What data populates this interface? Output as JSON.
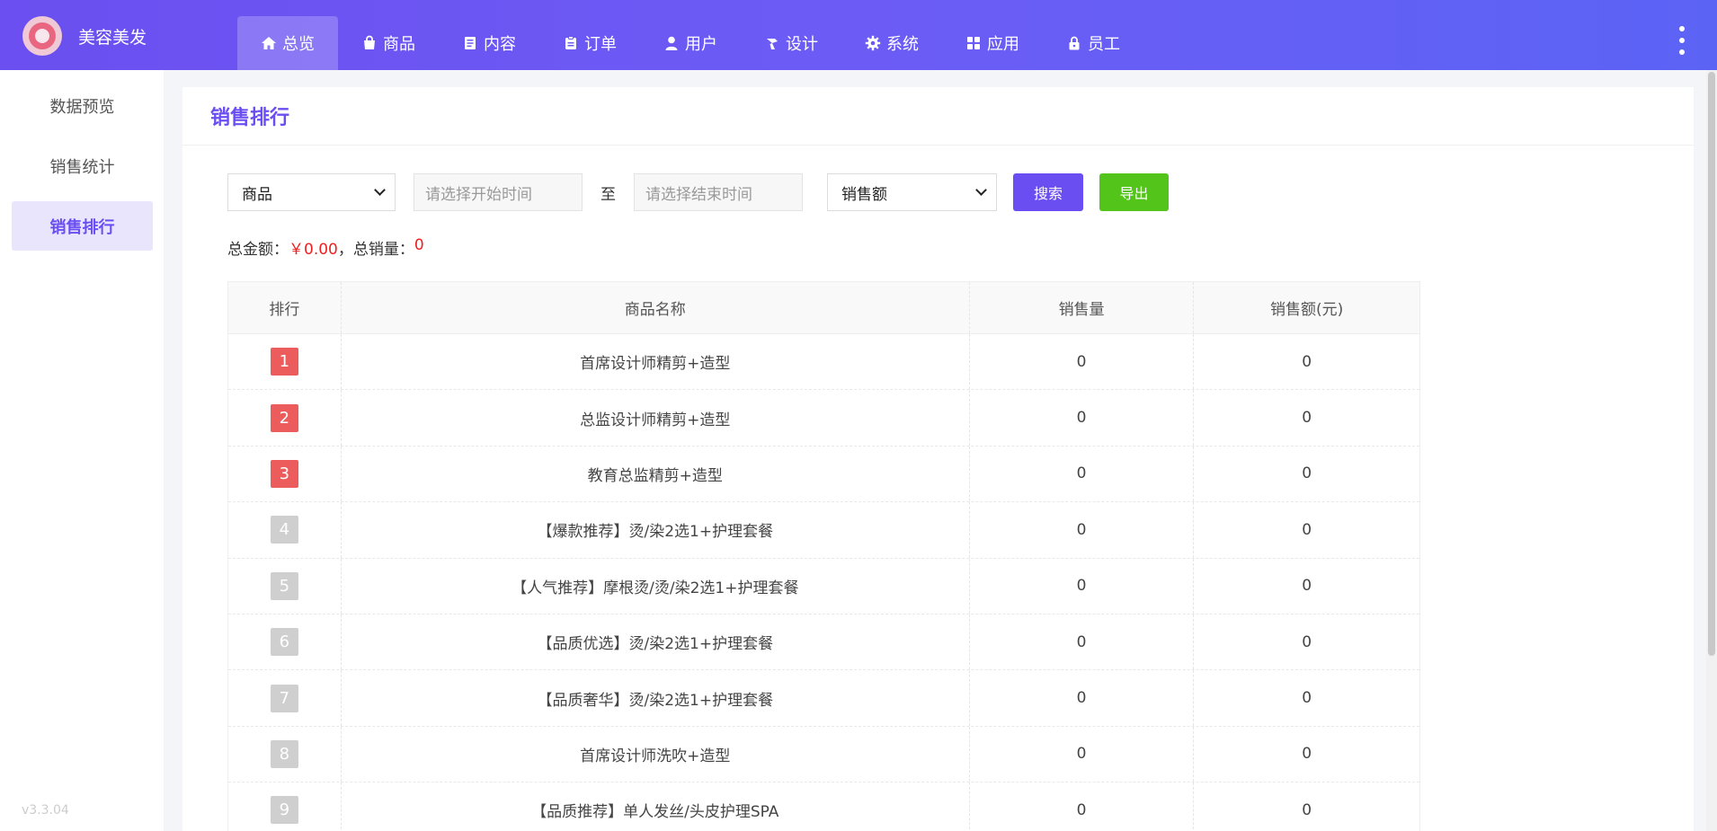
{
  "brand": {
    "name": "美容美发"
  },
  "nav": [
    {
      "label": "总览",
      "icon": "home-icon",
      "active": true
    },
    {
      "label": "商品",
      "icon": "bag-icon"
    },
    {
      "label": "内容",
      "icon": "document-icon"
    },
    {
      "label": "订单",
      "icon": "clipboard-icon"
    },
    {
      "label": "用户",
      "icon": "user-icon"
    },
    {
      "label": "设计",
      "icon": "paint-icon"
    },
    {
      "label": "系统",
      "icon": "gear-icon"
    },
    {
      "label": "应用",
      "icon": "apps-grid-icon"
    },
    {
      "label": "员工",
      "icon": "lock-icon"
    }
  ],
  "sidebar": {
    "items": [
      {
        "label": "数据预览"
      },
      {
        "label": "销售统计"
      },
      {
        "label": "销售排行",
        "active": true
      }
    ],
    "version": "v3.3.04"
  },
  "panel": {
    "title": "销售排行"
  },
  "filters": {
    "type_select": "商品",
    "start_placeholder": "请选择开始时间",
    "to_label": "至",
    "end_placeholder": "请选择结束时间",
    "sort_select": "销售额",
    "search_label": "搜索",
    "export_label": "导出"
  },
  "summary": {
    "amount_label": "总金额：",
    "amount_value": "￥0.00",
    "separator": "，",
    "qty_label": "总销量：",
    "qty_value": "0"
  },
  "table": {
    "headers": [
      "排行",
      "商品名称",
      "销售量",
      "销售额(元)"
    ],
    "rows": [
      {
        "rank": "1",
        "name": "首席设计师精剪+造型",
        "qty": "0",
        "amount": "0"
      },
      {
        "rank": "2",
        "name": "总监设计师精剪+造型",
        "qty": "0",
        "amount": "0"
      },
      {
        "rank": "3",
        "name": "教育总监精剪+造型",
        "qty": "0",
        "amount": "0"
      },
      {
        "rank": "4",
        "name": "【爆款推荐】烫/染2选1+护理套餐",
        "qty": "0",
        "amount": "0"
      },
      {
        "rank": "5",
        "name": "【人气推荐】摩根烫/烫/染2选1+护理套餐",
        "qty": "0",
        "amount": "0"
      },
      {
        "rank": "6",
        "name": "【品质优选】烫/染2选1+护理套餐",
        "qty": "0",
        "amount": "0"
      },
      {
        "rank": "7",
        "name": "【品质奢华】烫/染2选1+护理套餐",
        "qty": "0",
        "amount": "0"
      },
      {
        "rank": "8",
        "name": "首席设计师洗吹+造型",
        "qty": "0",
        "amount": "0"
      },
      {
        "rank": "9",
        "name": "【品质推荐】单人发丝/头皮护理SPA",
        "qty": "0",
        "amount": "0"
      }
    ]
  },
  "colors": {
    "accent": "#6a4ef2",
    "export": "#52c41a",
    "rank_top": "#ec5c5c",
    "rank_rest": "#cfcfcf",
    "money": "#f01f1f"
  }
}
